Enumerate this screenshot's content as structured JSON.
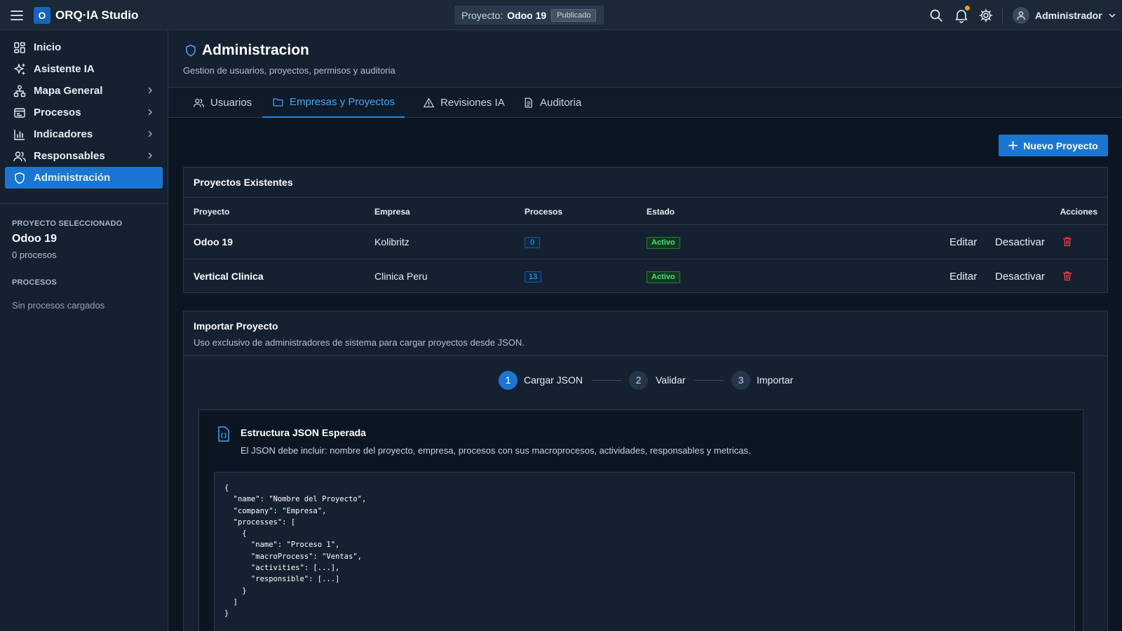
{
  "app": {
    "logo_letter": "O",
    "title": "ORQ·IA Studio"
  },
  "topbar": {
    "project_label": "Proyecto:",
    "project_name": "Odoo 19",
    "project_status": "Publicado",
    "user_name": "Administrador",
    "icons": [
      "menu-icon",
      "search-icon",
      "bell-icon",
      "gear-icon",
      "user-icon",
      "chevron-down-icon"
    ]
  },
  "sidebar": {
    "items": [
      {
        "label": "Inicio",
        "icon": "dashboard-icon",
        "has_children": false,
        "active": false
      },
      {
        "label": "Asistente IA",
        "icon": "sparkles-icon",
        "has_children": false,
        "active": false
      },
      {
        "label": "Mapa General",
        "icon": "sitemap-icon",
        "has_children": true,
        "active": false
      },
      {
        "label": "Procesos",
        "icon": "process-icon",
        "has_children": true,
        "active": false
      },
      {
        "label": "Indicadores",
        "icon": "bar-chart-icon",
        "has_children": true,
        "active": false
      },
      {
        "label": "Responsables",
        "icon": "users-icon",
        "has_children": true,
        "active": false
      },
      {
        "label": "Administración",
        "icon": "shield-icon",
        "has_children": false,
        "active": true
      }
    ],
    "selected_project_heading": "PROYECTO SELECCIONADO",
    "selected_project_name": "Odoo 19",
    "selected_project_count": "0 procesos",
    "processes_heading": "PROCESOS",
    "processes_empty": "Sin procesos cargados"
  },
  "page": {
    "title": "Administracion",
    "subtitle": "Gestion de usuarios, proyectos, permisos y auditoria"
  },
  "tabs": [
    {
      "label": "Usuarios",
      "icon": "users-icon",
      "active": false
    },
    {
      "label": "Empresas y Proyectos",
      "icon": "folder-icon",
      "active": true
    },
    {
      "label": "Revisiones IA",
      "icon": "warning-icon",
      "active": false
    },
    {
      "label": "Auditoria",
      "icon": "document-icon",
      "active": false
    }
  ],
  "new_project_button": "Nuevo Proyecto",
  "projects_table": {
    "title": "Proyectos Existentes",
    "columns": [
      "Proyecto",
      "Empresa",
      "Procesos",
      "Estado",
      "Acciones"
    ],
    "rows": [
      {
        "project": "Odoo 19",
        "company": "Kolibritz",
        "processes": "0",
        "status": "Activo"
      },
      {
        "project": "Vertical Clinica",
        "company": "Clinica Peru",
        "processes": "13",
        "status": "Activo"
      }
    ],
    "actions": {
      "edit": "Editar",
      "deactivate": "Desactivar"
    }
  },
  "import": {
    "title": "Importar Proyecto",
    "subtitle": "Uso exclusivo de administradores de sistema para cargar proyectos desde JSON.",
    "steps": [
      {
        "number": "1",
        "label": "Cargar JSON",
        "state": "current"
      },
      {
        "number": "2",
        "label": "Validar",
        "state": "pending"
      },
      {
        "number": "3",
        "label": "Importar",
        "state": "pending"
      }
    ],
    "json_title": "Estructura JSON Esperada",
    "json_description": "El JSON debe incluir: nombre del proyecto, empresa, procesos con sus macroprocesos, actividades, responsables y metricas.",
    "json_example": "{\n  \"name\": \"Nombre del Proyecto\",\n  \"company\": \"Empresa\",\n  \"processes\": [\n    {\n      \"name\": \"Proceso 1\",\n      \"macroProcess\": \"Ventas\",\n      \"activities\": [...],\n      \"responsible\": [...]\n    }\n  ]\n}"
  },
  "colors": {
    "background": "#0b1622",
    "surface": "#152131",
    "accent": "#1976d2",
    "accent_text": "#42a5f5",
    "success": "#4ade80",
    "danger": "#ef4444",
    "notification": "#f59e0b"
  }
}
